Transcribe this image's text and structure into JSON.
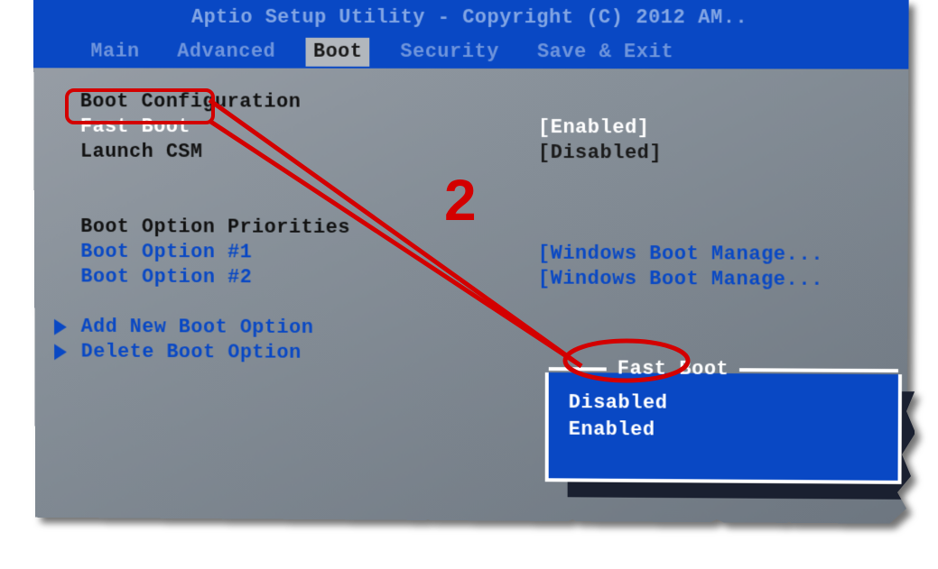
{
  "title": "Aptio Setup Utility - Copyright (C) 2012 AM..",
  "menu": {
    "items": [
      "Main",
      "Advanced",
      "Boot",
      "Security",
      "Save & Exit"
    ],
    "active_index": 2
  },
  "section_heading": "Boot Configuration",
  "settings": [
    {
      "label": "Fast Boot",
      "value": "[Enabled]",
      "selected": true
    },
    {
      "label": "Launch CSM",
      "value": "[Disabled]",
      "selected": false
    }
  ],
  "priorities_heading": "Boot Option Priorities",
  "priorities": [
    {
      "label": "Boot Option #1",
      "value": "[Windows Boot Manage..."
    },
    {
      "label": "Boot Option #2",
      "value": "[Windows Boot Manage..."
    }
  ],
  "actions": [
    "Add New Boot Option",
    "Delete Boot Option"
  ],
  "popup": {
    "title": "Fast Boot",
    "options": [
      "Disabled",
      "Enabled"
    ],
    "selected_index": 0
  },
  "annotation": {
    "step_number": "2"
  }
}
